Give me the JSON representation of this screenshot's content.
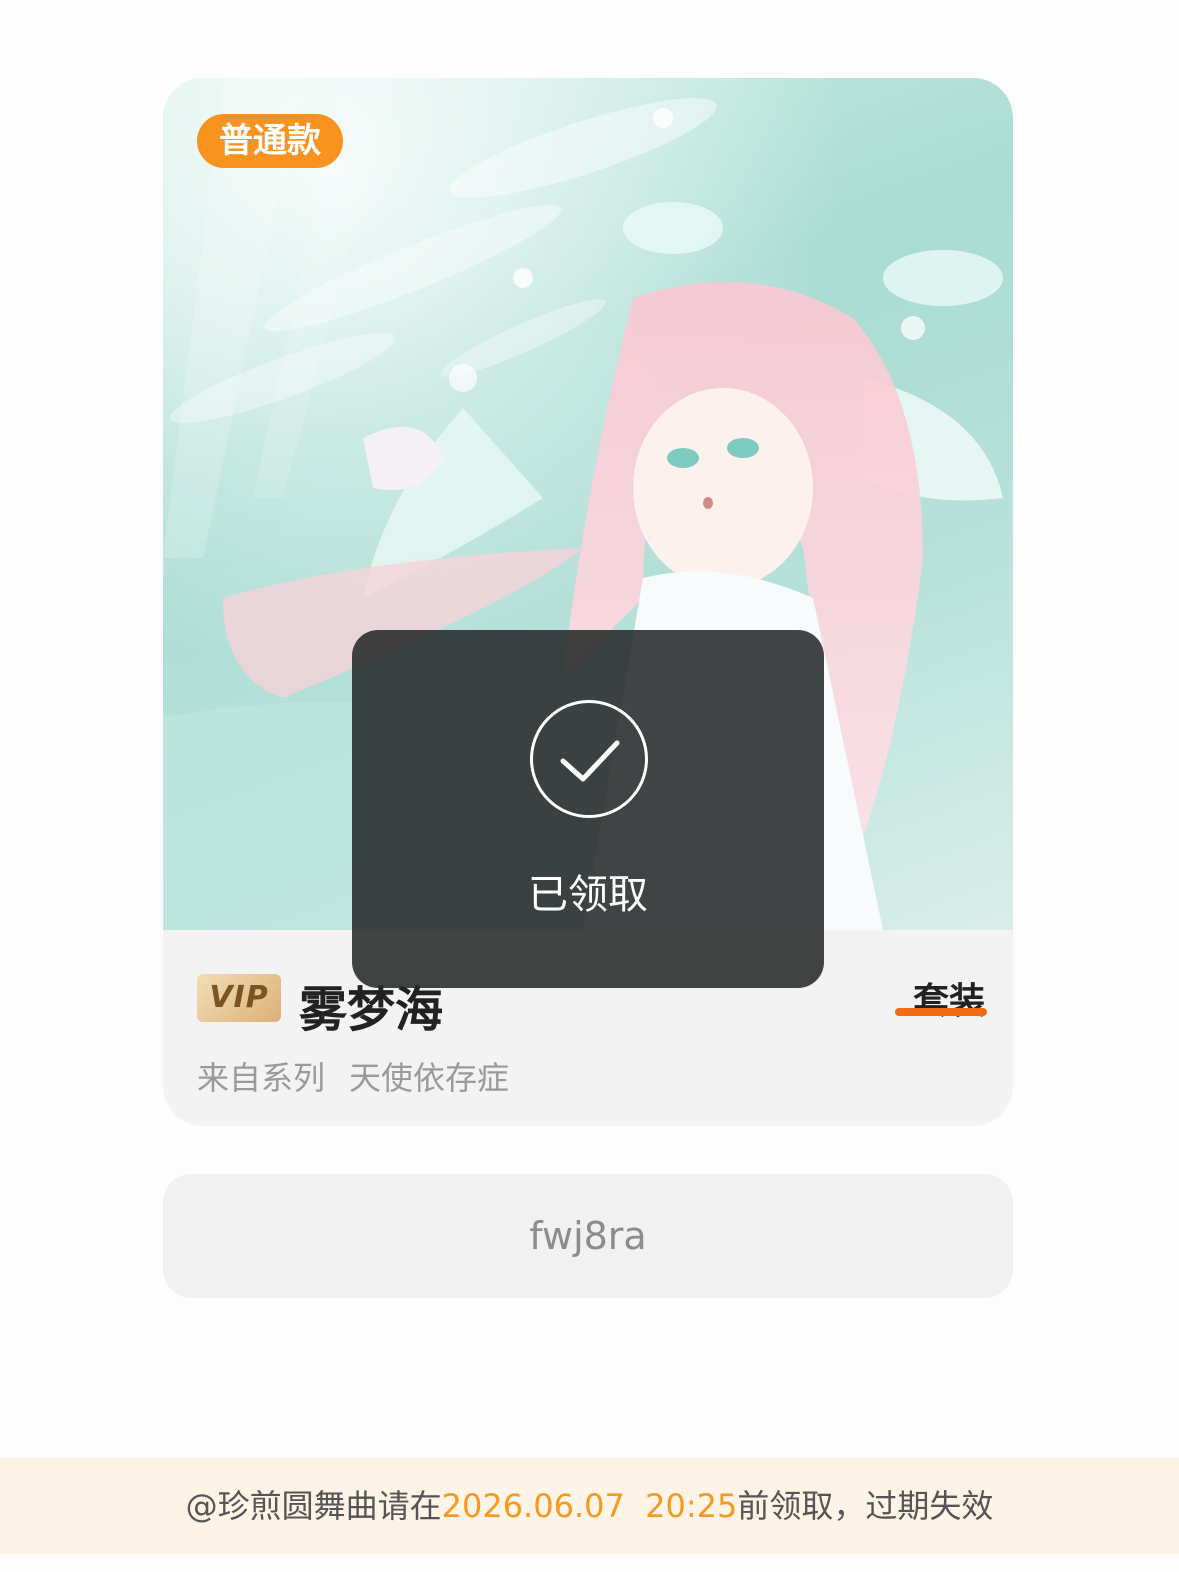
{
  "card": {
    "tag": "普通款",
    "vip_badge": "VIP",
    "name": "雾梦海",
    "type": "套装",
    "series_prefix": "来自系列",
    "series_name": "天使依存症"
  },
  "code": "fwj8ra",
  "toast": {
    "text": "已领取"
  },
  "footer": {
    "prefix": "@珍煎圆舞曲请在",
    "deadline": "2026.06.07  20:25",
    "suffix": "前领取，过期失效"
  },
  "colors": {
    "accent": "#f7931e",
    "highlight": "#f59a1f",
    "underline": "#f56b12"
  },
  "icons": {
    "toast": "check-circle-icon"
  }
}
